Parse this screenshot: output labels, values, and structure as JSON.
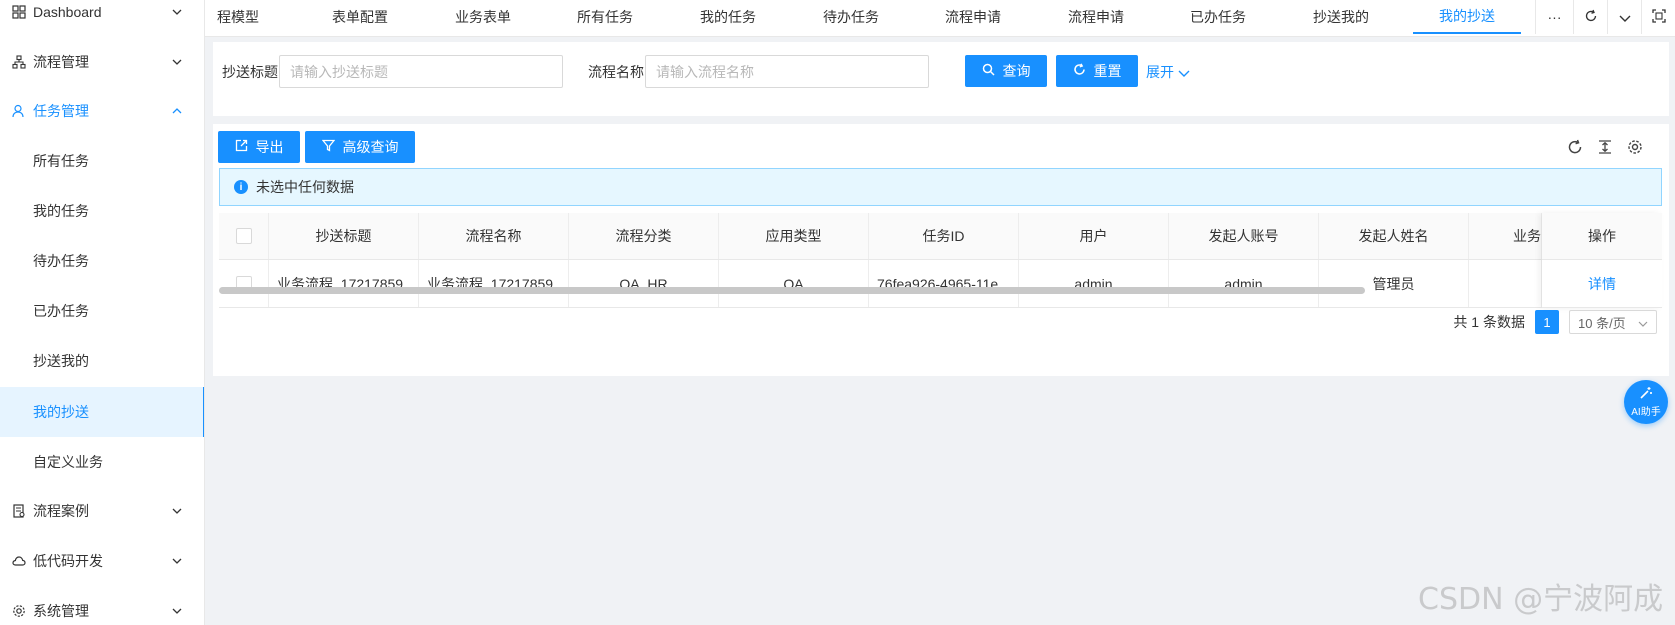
{
  "sidebar": {
    "items": [
      {
        "label": "Dashboard",
        "icon": "dashboard-icon"
      },
      {
        "label": "流程管理",
        "icon": "flow-icon"
      },
      {
        "label": "任务管理",
        "icon": "user-task-icon"
      },
      {
        "label": "所有任务"
      },
      {
        "label": "我的任务"
      },
      {
        "label": "待办任务"
      },
      {
        "label": "已办任务"
      },
      {
        "label": "抄送我的"
      },
      {
        "label": "我的抄送"
      },
      {
        "label": "自定义业务"
      },
      {
        "label": "流程案例",
        "icon": "doc-icon"
      },
      {
        "label": "低代码开发",
        "icon": "cloud-icon"
      },
      {
        "label": "系统管理",
        "icon": "gear-icon"
      }
    ]
  },
  "tabs": {
    "items": [
      "程模型",
      "表单配置",
      "业务表单",
      "所有任务",
      "我的任务",
      "待办任务",
      "流程申请",
      "流程申请",
      "已办任务",
      "抄送我的",
      "我的抄送"
    ],
    "more": "···"
  },
  "search": {
    "title_label": "抄送标题",
    "title_placeholder": "请输入抄送标题",
    "flow_label": "流程名称",
    "flow_placeholder": "请输入流程名称",
    "query_button": "查询",
    "reset_button": "重置",
    "expand_link": "展开"
  },
  "toolbar": {
    "export_button": "导出",
    "advanced_button": "高级查询"
  },
  "alert": {
    "text": "未选中任何数据"
  },
  "table": {
    "headers": [
      "抄送标题",
      "流程名称",
      "流程分类",
      "应用类型",
      "任务ID",
      "用户",
      "发起人账号",
      "发起人姓名",
      "业务",
      "操作"
    ],
    "rows": [
      {
        "title": "业务流程_17217859...",
        "flow_name": "业务流程_17217859...",
        "category": "OA_HR",
        "app_type": "OA",
        "task_id": "76fea926-4965-11e...",
        "user": "admin",
        "initiator_account": "admin",
        "initiator_name": "管理员",
        "business": "",
        "action": "详情"
      }
    ]
  },
  "pagination": {
    "total_text": "共 1 条数据",
    "current_page": "1",
    "page_size": "10 条/页"
  },
  "ai_button": {
    "label": "AI助手"
  },
  "watermark": "CSDN @宁波阿成",
  "colors": {
    "accent": "#1890ff",
    "active_bg": "#e6f4ff",
    "alert_bg": "#e6f7ff"
  }
}
